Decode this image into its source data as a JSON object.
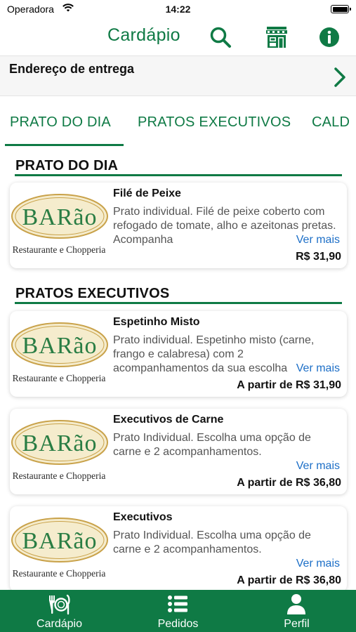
{
  "status_bar": {
    "carrier": "Operadora",
    "time": "14:22"
  },
  "header": {
    "title": "Cardápio"
  },
  "address": {
    "label": "Endereço de entrega"
  },
  "tabs": [
    {
      "label": "PRATO DO DIA"
    },
    {
      "label": "PRATOS EXECUTIVOS"
    },
    {
      "label": "CALD"
    }
  ],
  "logo": {
    "brand": "BARão",
    "subtitle": "Restaurante e Chopperia"
  },
  "sections": [
    {
      "title": "PRATO DO DIA",
      "items": [
        {
          "name": "Filé de Peixe",
          "description": "Prato individual. Filé de peixe coberto com refogado de tomate, alho e azeitonas pretas. Acompanha",
          "more": "Ver mais",
          "price": "R$ 31,90"
        }
      ]
    },
    {
      "title": "PRATOS EXECUTIVOS",
      "items": [
        {
          "name": "Espetinho Misto",
          "description": "Prato individual. Espetinho misto (carne, frango e calabresa) com 2 acompanhamentos da sua escolha",
          "more": "Ver mais",
          "price": "A partir de R$ 31,90"
        },
        {
          "name": "Executivos de Carne",
          "description": "Prato Individual. Escolha uma opção de carne e 2 acompanhamentos.",
          "more": "Ver mais",
          "price": "A partir de R$ 36,80"
        },
        {
          "name": "Executivos",
          "description": "Prato Individual. Escolha uma opção de carne e 2 acompanhamentos.",
          "more": "Ver mais",
          "price": "A partir de R$ 36,80"
        }
      ]
    }
  ],
  "bottom_nav": [
    {
      "label": "Cardápio",
      "icon": "cutlery-icon"
    },
    {
      "label": "Pedidos",
      "icon": "list-icon"
    },
    {
      "label": "Perfil",
      "icon": "person-icon"
    }
  ],
  "colors": {
    "brand_green": "#0f7a45",
    "link_blue": "#1d6fc7",
    "logo_gold": "#c9a24a",
    "logo_cream": "#f5eccd"
  }
}
